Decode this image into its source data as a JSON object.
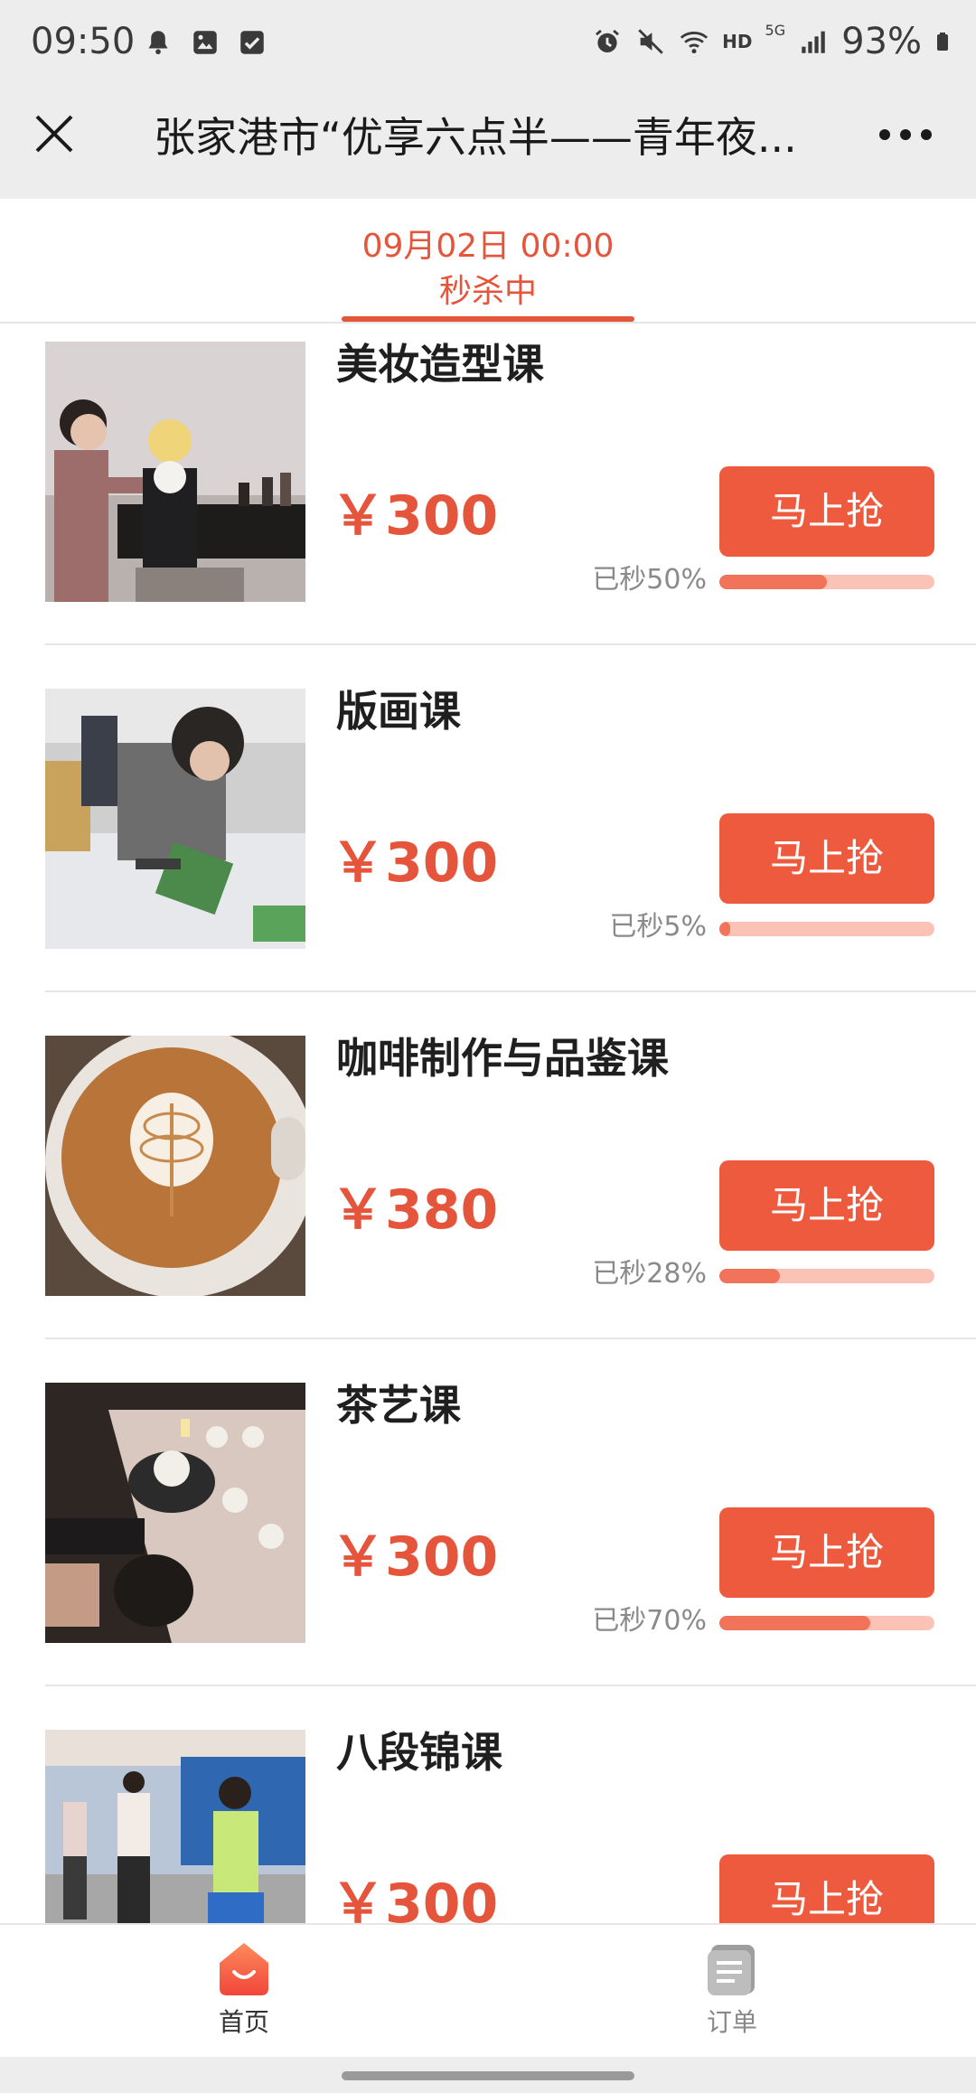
{
  "status_bar": {
    "time": "09:50",
    "battery": "93%",
    "network_badge": "HD",
    "network_gen": "5G",
    "left_icons": [
      "bell-icon",
      "image-icon",
      "checkbox-icon"
    ],
    "right_icons": [
      "alarm-icon",
      "mute-icon",
      "wifi-icon",
      "signal-icon",
      "battery-icon"
    ]
  },
  "header": {
    "title": "张家港市“优享六点半——青年夜...",
    "close_icon": "close-icon",
    "more_icon": "more-icon"
  },
  "session": {
    "time": "09月02日 00:00",
    "status": "秒杀中"
  },
  "colors": {
    "accent": "#e4553b",
    "button": "#ee5a3e",
    "progress_track": "#fbc2b6",
    "progress_fill": "#f17359"
  },
  "products": [
    {
      "name": "美妆造型课",
      "price": "￥300",
      "button": "马上抢",
      "sold_text": "已秒50%",
      "sold_fraction": 0.5,
      "image": "makeup-class-photo"
    },
    {
      "name": "版画课",
      "price": "￥300",
      "button": "马上抢",
      "sold_text": "已秒5%",
      "sold_fraction": 0.05,
      "image": "printmaking-class-photo"
    },
    {
      "name": "咖啡制作与品鉴课",
      "price": "￥380",
      "button": "马上抢",
      "sold_text": "已秒28%",
      "sold_fraction": 0.28,
      "image": "coffee-latte-photo"
    },
    {
      "name": "茶艺课",
      "price": "￥300",
      "button": "马上抢",
      "sold_text": "已秒70%",
      "sold_fraction": 0.7,
      "image": "tea-ceremony-photo"
    },
    {
      "name": "八段锦课",
      "price": "￥300",
      "button": "马上抢",
      "image": "baduanjin-class-photo"
    }
  ],
  "bottom_nav": {
    "items": [
      {
        "label": "首页",
        "icon": "home-icon",
        "active": true
      },
      {
        "label": "订单",
        "icon": "orders-icon",
        "active": false
      }
    ]
  }
}
